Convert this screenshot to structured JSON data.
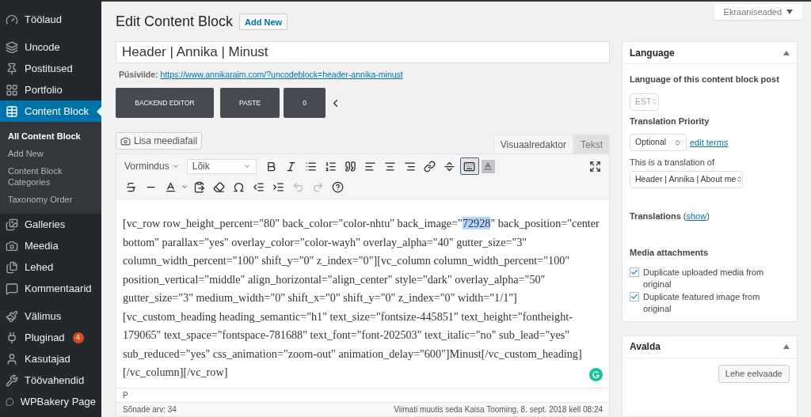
{
  "sidebar": {
    "items": [
      {
        "label": "Töölaud",
        "selected": false
      },
      {
        "label": "Uncode",
        "selected": false
      },
      {
        "label": "Postitused",
        "selected": false
      },
      {
        "label": "Portfolio",
        "selected": false
      },
      {
        "label": "Content Block",
        "selected": true,
        "children": [
          {
            "label": "All Content Block",
            "selected": true
          },
          {
            "label": "Add New",
            "selected": false
          },
          {
            "label": "Content Block Categories",
            "selected": false
          },
          {
            "label": "Taxonomy Order",
            "selected": false
          }
        ]
      },
      {
        "label": "Galleries",
        "selected": false
      },
      {
        "label": "Meedia",
        "selected": false
      },
      {
        "label": "Lehed",
        "selected": false
      },
      {
        "label": "Kommentaarid",
        "selected": false
      },
      {
        "label": "Välimus",
        "selected": false
      },
      {
        "label": "Pluginad",
        "selected": false,
        "badge": "4"
      },
      {
        "label": "Kasutajad",
        "selected": false
      },
      {
        "label": "Töövahendid",
        "selected": false
      },
      {
        "label": "WPBakery Page",
        "selected": false
      }
    ]
  },
  "screen_options": "Ekraaniseaded",
  "page_title": "Edit Content Block",
  "add_new": "Add New",
  "title_field": "Header | Annika | Minust",
  "permalink": {
    "label": "Püsiviide:",
    "url": "https://www.annikaraim.com/?uncodeblock=header-annika-minust"
  },
  "builder_buttons": [
    "BACKEND EDITOR",
    "PASTE",
    "0"
  ],
  "add_media": "Lisa meediafail",
  "editor_tabs": [
    {
      "label": "Visuaalredaktor",
      "selected": true
    },
    {
      "label": "Tekst",
      "selected": false
    }
  ],
  "toolbar": {
    "format_menu": "Vormindus",
    "block_select": "Lõik",
    "toggle_pressed": true,
    "undo_disabled": true,
    "redo_disabled": true
  },
  "content": {
    "before": "[vc_row row_height_percent=\"80\" back_color=\"color-nhtu\" back_image=\"",
    "selection": "72928",
    "after": "\" back_position=\"center bottom\" parallax=\"yes\" overlay_color=\"color-wayh\" overlay_alpha=\"40\" gutter_size=\"3\" column_width_percent=\"100\" shift_y=\"0\" z_index=\"0\"][vc_column column_width_percent=\"100\" position_vertical=\"middle\" align_horizontal=\"align_center\" style=\"dark\" overlay_alpha=\"50\" gutter_size=\"3\" medium_width=\"0\" shift_x=\"0\" shift_y=\"0\" z_index=\"0\" width=\"1/1\"] [vc_custom_heading heading_semantic=\"h1\" text_size=\"fontsize-445851\" text_height=\"fontheight-179065\" text_space=\"fontspace-781688\" text_font=\"font-202503\" text_italic=\"no\" sub_lead=\"yes\" sub_reduced=\"yes\" css_animation=\"zoom-out\" animation_delay=\"600\"]Minust[/vc_custom_heading] [/vc_column][/vc_row]"
  },
  "path": "P",
  "word_count": "Sõnade arv: 34",
  "last_edited": "Viimati muutis seda Kaisa Tooming, 8. sept. 2018 kell 08:24",
  "language_box": {
    "title": "Language",
    "language_label": "Language of this content block post",
    "language_select": {
      "value": "EST",
      "disabled": true
    },
    "priority_label": "Translation Priority",
    "priority_select": "Optional",
    "edit_terms": "edit terms",
    "translation_of_label": "This is a translation of",
    "translation_of_select": "Header | Annika | About me",
    "translations_label": "Translations",
    "translations_link": "show",
    "paren_open": "(",
    "paren_close": ")",
    "media_label": "Media attachments",
    "checkboxes": [
      {
        "label": "Duplicate uploaded media from original",
        "checked": true
      },
      {
        "label": "Duplicate featured image from original",
        "checked": true
      }
    ]
  },
  "publish_box": {
    "title": "Avalda",
    "preview_button": "Lehe eelvaade"
  }
}
